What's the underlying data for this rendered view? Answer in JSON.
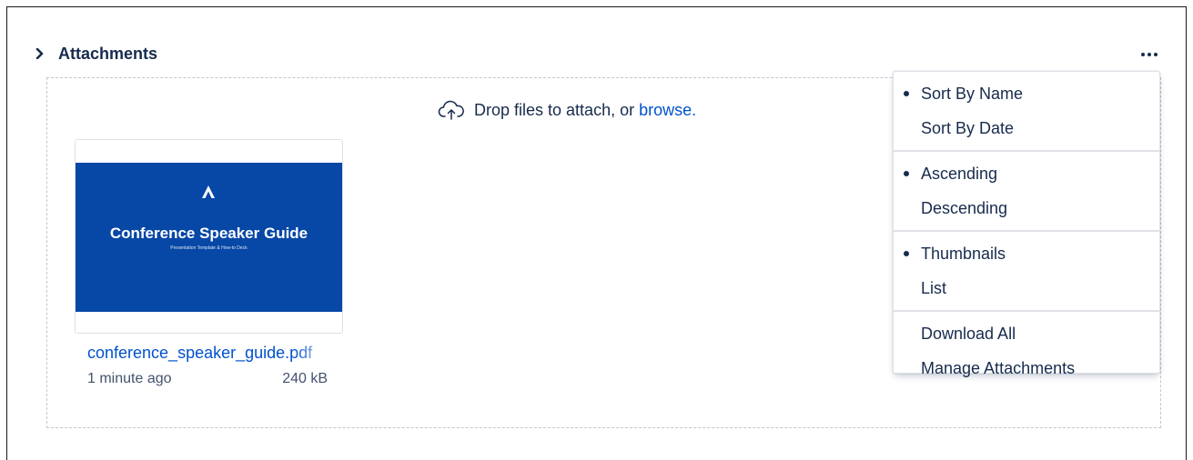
{
  "section": {
    "title": "Attachments"
  },
  "dropzone": {
    "message": "Drop files to attach, or",
    "browse_label": "browse."
  },
  "attachment": {
    "thumbnail": {
      "title": "Conference Speaker Guide",
      "subtitle": "Presentation Template & How-to Deck"
    },
    "file_name": "conference_speaker_guide.pdf",
    "time": "1 minute ago",
    "size": "240 kB"
  },
  "menu": {
    "groups": [
      [
        {
          "label": "Sort By Name",
          "selected": true
        },
        {
          "label": "Sort By Date",
          "selected": false
        }
      ],
      [
        {
          "label": "Ascending",
          "selected": true
        },
        {
          "label": "Descending",
          "selected": false
        }
      ],
      [
        {
          "label": "Thumbnails",
          "selected": true
        },
        {
          "label": "List",
          "selected": false
        }
      ],
      [
        {
          "label": "Download All",
          "selected": false
        },
        {
          "label": "Manage Attachments",
          "selected": false
        }
      ]
    ]
  },
  "colors": {
    "link": "#0052cc",
    "thumbnail_bg": "#0747a6",
    "text": "#172b4d",
    "muted": "#42526e"
  }
}
